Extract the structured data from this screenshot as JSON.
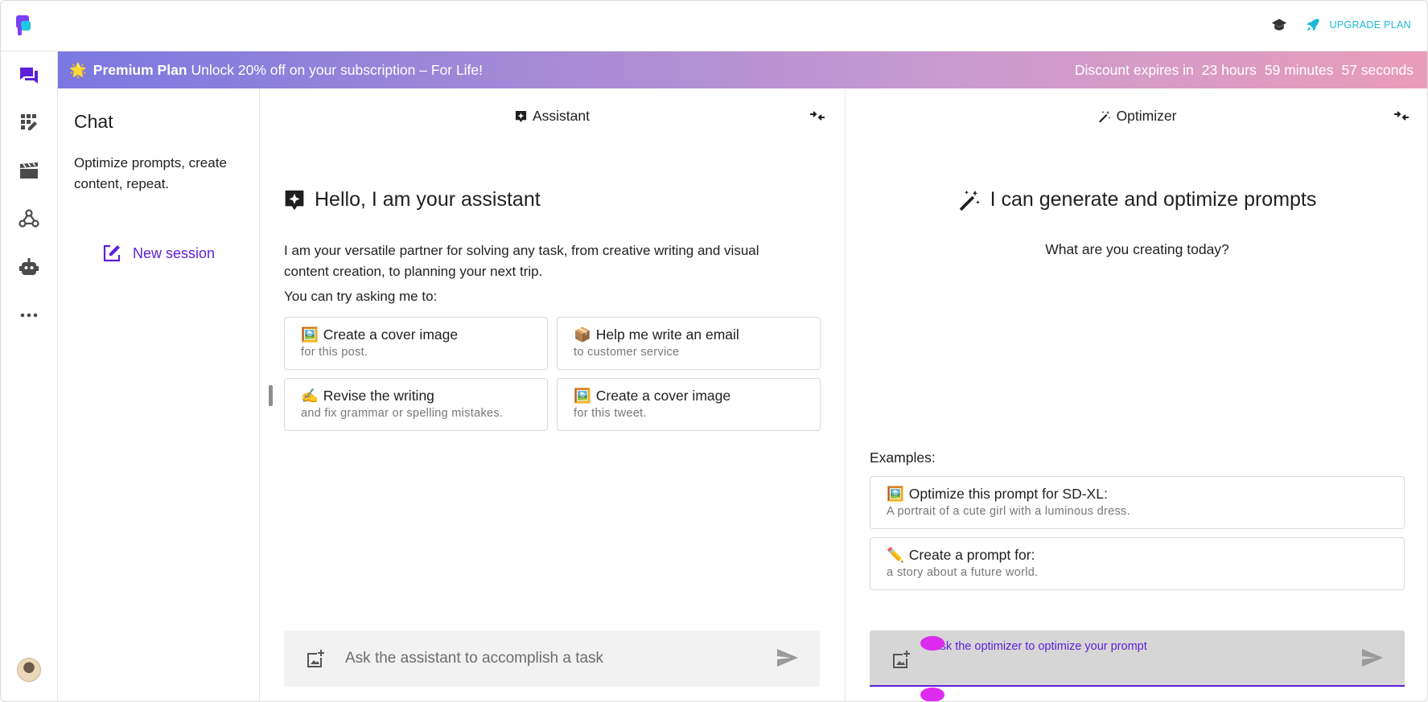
{
  "top": {
    "upgrade_label": "UPGRADE PLAN"
  },
  "banner": {
    "emoji": "🌟",
    "plan": "Premium Plan",
    "offer": "Unlock 20% off on your subscription – For Life!",
    "expires_label": "Discount expires in",
    "hours": "23 hours",
    "minutes": "59 minutes",
    "seconds": "57 seconds"
  },
  "chat": {
    "title": "Chat",
    "description": "Optimize prompts, create content, repeat.",
    "new_session": "New session"
  },
  "assistant": {
    "header": "Assistant",
    "hello": "Hello, I am your assistant",
    "intro": "I am your versatile partner for solving any task, from creative writing and visual content creation, to planning your next trip.",
    "try_label": "You can try asking me to:",
    "suggestions": [
      {
        "emoji": "🖼️",
        "title": "Create a cover image",
        "sub": "for this post."
      },
      {
        "emoji": "📦",
        "title": "Help me write an email",
        "sub": "to customer service"
      },
      {
        "emoji": "✍️",
        "title": "Revise the writing",
        "sub": "and fix grammar or spelling mistakes."
      },
      {
        "emoji": "🖼️",
        "title": "Create a cover image",
        "sub": "for this tweet."
      }
    ],
    "input_placeholder": "Ask the assistant to accomplish a task"
  },
  "optimizer": {
    "header": "Optimizer",
    "title": "I can generate and optimize prompts",
    "subtitle": "What are you creating today?",
    "examples_label": "Examples:",
    "examples": [
      {
        "emoji": "🖼️",
        "title": "Optimize this prompt for SD-XL:",
        "sub": "A portrait of a cute girl with a luminous dress."
      },
      {
        "emoji": "✏️",
        "title": "Create a prompt for:",
        "sub": "a story about a future world."
      }
    ],
    "input_label": "Ask the optimizer to optimize your prompt"
  },
  "colors": {
    "accent": "#5d1fd8",
    "upgrade": "#1fb8d6"
  }
}
